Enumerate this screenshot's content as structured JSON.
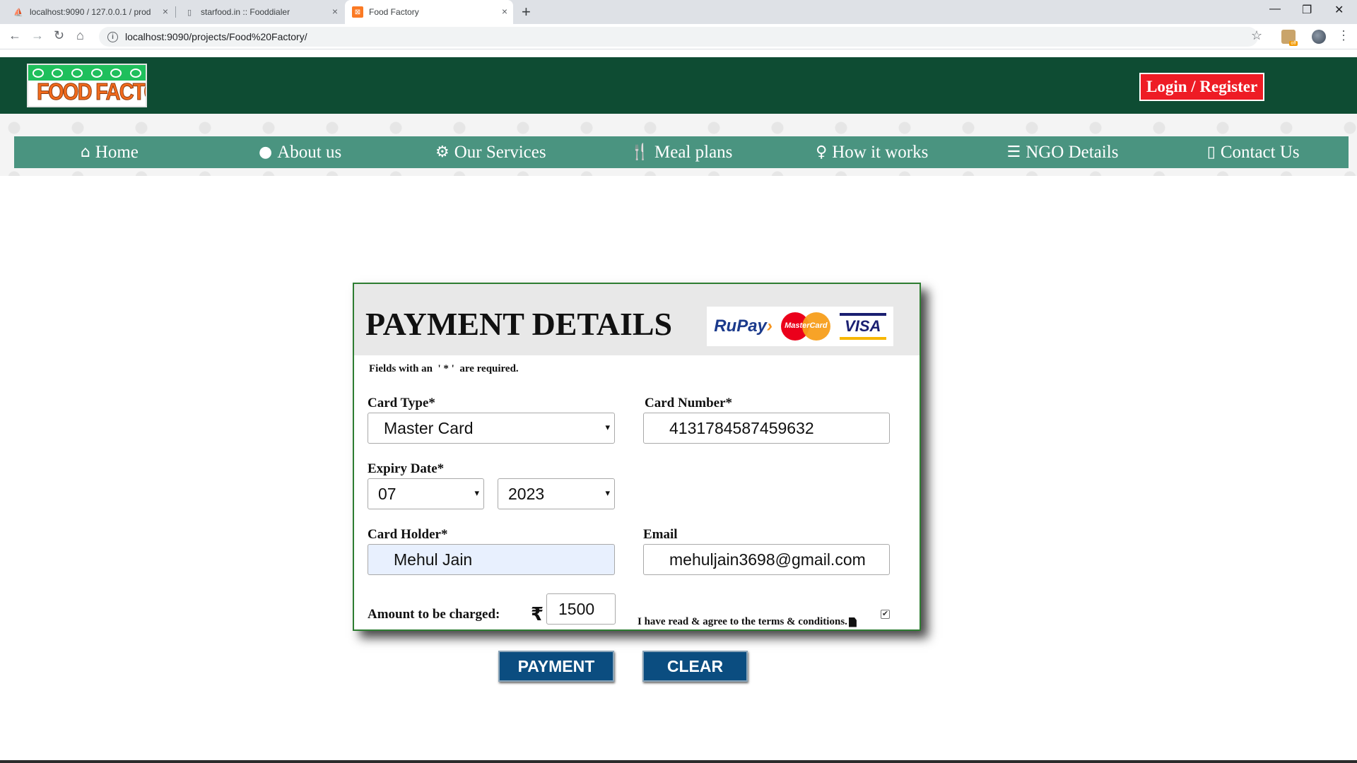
{
  "browser": {
    "tabs": [
      {
        "title": "localhost:9090 / 127.0.0.1 / prod",
        "close": "×"
      },
      {
        "title": "starfood.in :: Fooddialer",
        "close": "×"
      },
      {
        "title": "Food Factory",
        "close": "×"
      }
    ],
    "new_tab": "+",
    "url": "localhost:9090/projects/Food%20Factory/",
    "window_controls": {
      "minimize": "—",
      "restore": "❐",
      "close": "✕"
    },
    "nav": {
      "back": "←",
      "forward": "→",
      "reload": "↻",
      "home": "⌂",
      "star": "☆",
      "menu": "⋮",
      "ext_badge": "off"
    }
  },
  "header": {
    "logo_text": "FOOD FACTORY",
    "login_label": "Login / Register"
  },
  "nav": [
    {
      "icon": "home-icon",
      "glyph": "⌂",
      "label": "Home"
    },
    {
      "icon": "user-icon",
      "glyph": "●",
      "label": "About us"
    },
    {
      "icon": "gear-icon",
      "glyph": "⚙",
      "label": "Our Services"
    },
    {
      "icon": "cutlery-icon",
      "glyph": "🍴",
      "label": "Meal plans"
    },
    {
      "icon": "lightbulb-icon",
      "glyph": "♀",
      "label": "How it works"
    },
    {
      "icon": "list-icon",
      "glyph": "☰",
      "label": "NGO Details"
    },
    {
      "icon": "mobile-icon",
      "glyph": "▯",
      "label": "Contact Us"
    }
  ],
  "payment": {
    "title": "PAYMENT DETAILS",
    "card_brands": {
      "rupay": "RuPay",
      "mastercard": "MasterCard",
      "visa": "VISA"
    },
    "required_note": "Fields with an  ' * '  are required.",
    "card_type": {
      "label": "Card Type*",
      "value": "Master Card"
    },
    "card_number": {
      "label": "Card Number*",
      "value": "4131784587459632"
    },
    "expiry": {
      "label": "Expiry Date*",
      "month": "07",
      "year": "2023"
    },
    "card_holder": {
      "label": "Card Holder*",
      "value": "Mehul Jain"
    },
    "email": {
      "label": "Email",
      "value": "mehuljain3698@gmail.com"
    },
    "amount": {
      "label": "Amount to be charged:",
      "currency": "₹",
      "value": "1500"
    },
    "terms": {
      "text": "I have read & agree to the terms & conditions.",
      "checked": true
    },
    "buttons": {
      "payment": "PAYMENT",
      "clear": "CLEAR"
    }
  }
}
